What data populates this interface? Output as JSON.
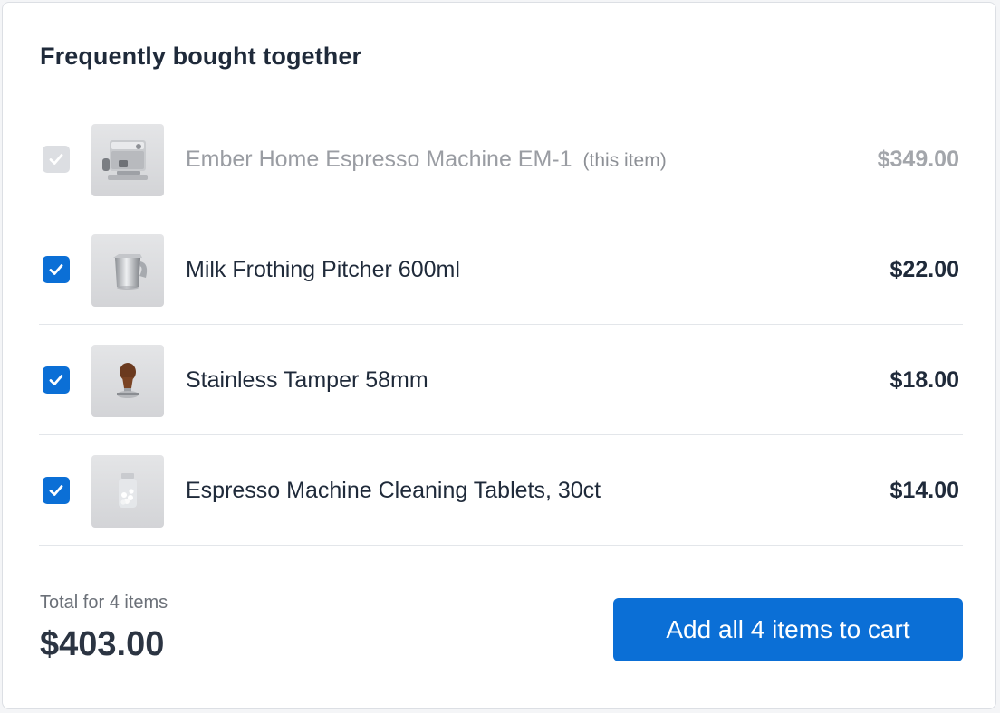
{
  "widget": {
    "title": "Frequently bought together"
  },
  "items": [
    {
      "name": "Ember Home Espresso Machine EM-1",
      "tag": "(this item)",
      "price": "$349.00",
      "checked": true,
      "disabled": true,
      "icon": "espresso-machine-image"
    },
    {
      "name": "Milk Frothing Pitcher 600ml",
      "price": "$22.00",
      "checked": true,
      "disabled": false,
      "icon": "milk-pitcher-image"
    },
    {
      "name": "Stainless Tamper 58mm",
      "price": "$18.00",
      "checked": true,
      "disabled": false,
      "icon": "tamper-image"
    },
    {
      "name": "Espresso Machine Cleaning Tablets, 30ct",
      "price": "$14.00",
      "checked": true,
      "disabled": false,
      "icon": "cleaning-tablets-jar-image"
    }
  ],
  "summary": {
    "total_label": "Total for 4 items",
    "total_value": "$403.00",
    "cta_label": "Add all 4 items to cart"
  },
  "colors": {
    "accent": "#0b6fd6",
    "text": "#1f2a3a",
    "muted_text": "#9a9da3",
    "checkbox_disabled": "#dcdee2",
    "divider": "#e3e6ea"
  }
}
